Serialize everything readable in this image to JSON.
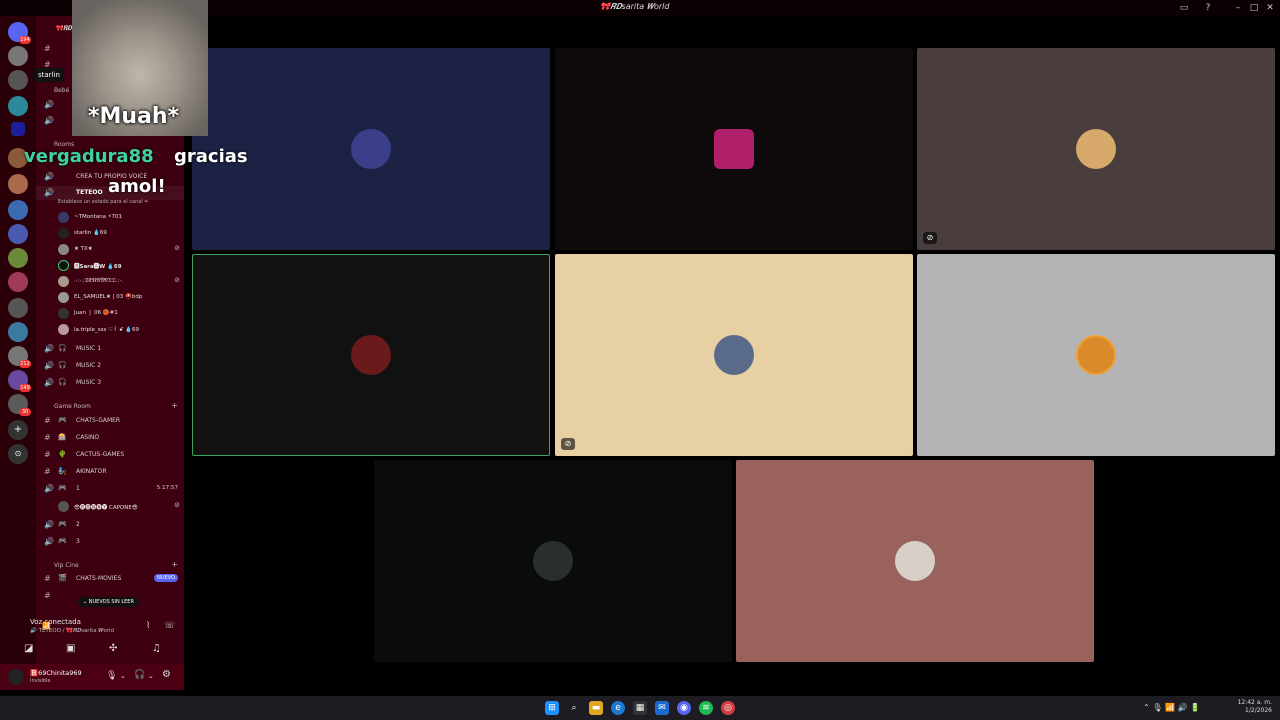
{
  "window": {
    "title": "🎀𝑹𝑫sarita 𝑾orld"
  },
  "overlay": {
    "caption": "*Muah*",
    "chat_user": "vergadura88",
    "chat_msg_1": "gracias",
    "chat_msg_2": "amol!",
    "tooltip": "starlin"
  },
  "rail": {
    "badges": [
      "194",
      "212",
      "149",
      "30"
    ]
  },
  "sidebar": {
    "server_name": "🎀𝑹𝑫",
    "categories": {
      "bebe": "Bebé",
      "rooms": "Rooms",
      "game_room": "Game Room",
      "vip_cine": "Vip Cine"
    },
    "create_voice": "CREA TU PROPIO VOICE",
    "teteo_channel": "TETEOO",
    "teteo_status": "Establece un estado para el canal ✏",
    "members": [
      "~TMontana ⚡701",
      "starlin 💧69",
      "★ TX★",
      "🅱Sara🅰W 💧69",
      ".·:·.:𝔖𝔈ℜ𝔑𝔄𝔑𝔇𝔒.:·.",
      "EL_SAMUEL★ | 03 ⛑️bdp",
      "Juan ❘ 06 🏀#1",
      "la.triple_sss ♡꒱ ꗃ 💧69"
    ],
    "music": [
      "MUSIC 1",
      "MUSIC 2",
      "MUSIC 3"
    ],
    "game_channels": [
      "CHATS-GAMER",
      "CASINO",
      "CACTUS-GAMES",
      "AKINATOR"
    ],
    "game_voice_1": "1",
    "game_voice_1_timer": "5:17:57",
    "game_voice_member": "😎🅡🅞🅝🅝🅨 CAPONE😎",
    "game_voice_2": "2",
    "game_voice_3": "3",
    "vip_channel": "CHATS-MOVIES",
    "new_badge": "NUEVO",
    "unread_pill": "NUEVOS SIN LEER"
  },
  "voice": {
    "status": "Voz conectada",
    "location": "🔊 TETEOO / 🎀𝑹𝑫sarita 𝑾orld"
  },
  "user": {
    "name": "🅱️69Chinita969",
    "status": "Invisible"
  },
  "tiles": [
    {
      "bg": "#1d2244",
      "avatar": "#3b3f8a",
      "muted": false
    },
    {
      "bg": "#0e0a0c",
      "avatar": "#b0206a",
      "muted": false
    },
    {
      "bg": "#4a3d3d",
      "avatar": "#d7a96b",
      "muted": true
    },
    {
      "bg": "#111111",
      "avatar": "#6a1a1a",
      "muted": false,
      "speaking": true
    },
    {
      "bg": "#e8d0a5",
      "avatar": "#5a6a8a",
      "muted": true
    },
    {
      "bg": "#b4b4b4",
      "avatar": "#d98a2a",
      "muted": false
    },
    {
      "bg": "#0a0c0b",
      "avatar": "#2a2e2c",
      "muted": false
    },
    {
      "bg": "#9a625c",
      "avatar": "#d9cfc9",
      "muted": false
    }
  ],
  "taskbar": {
    "time": "12:42 a. m.",
    "date": "1/2/2026"
  }
}
